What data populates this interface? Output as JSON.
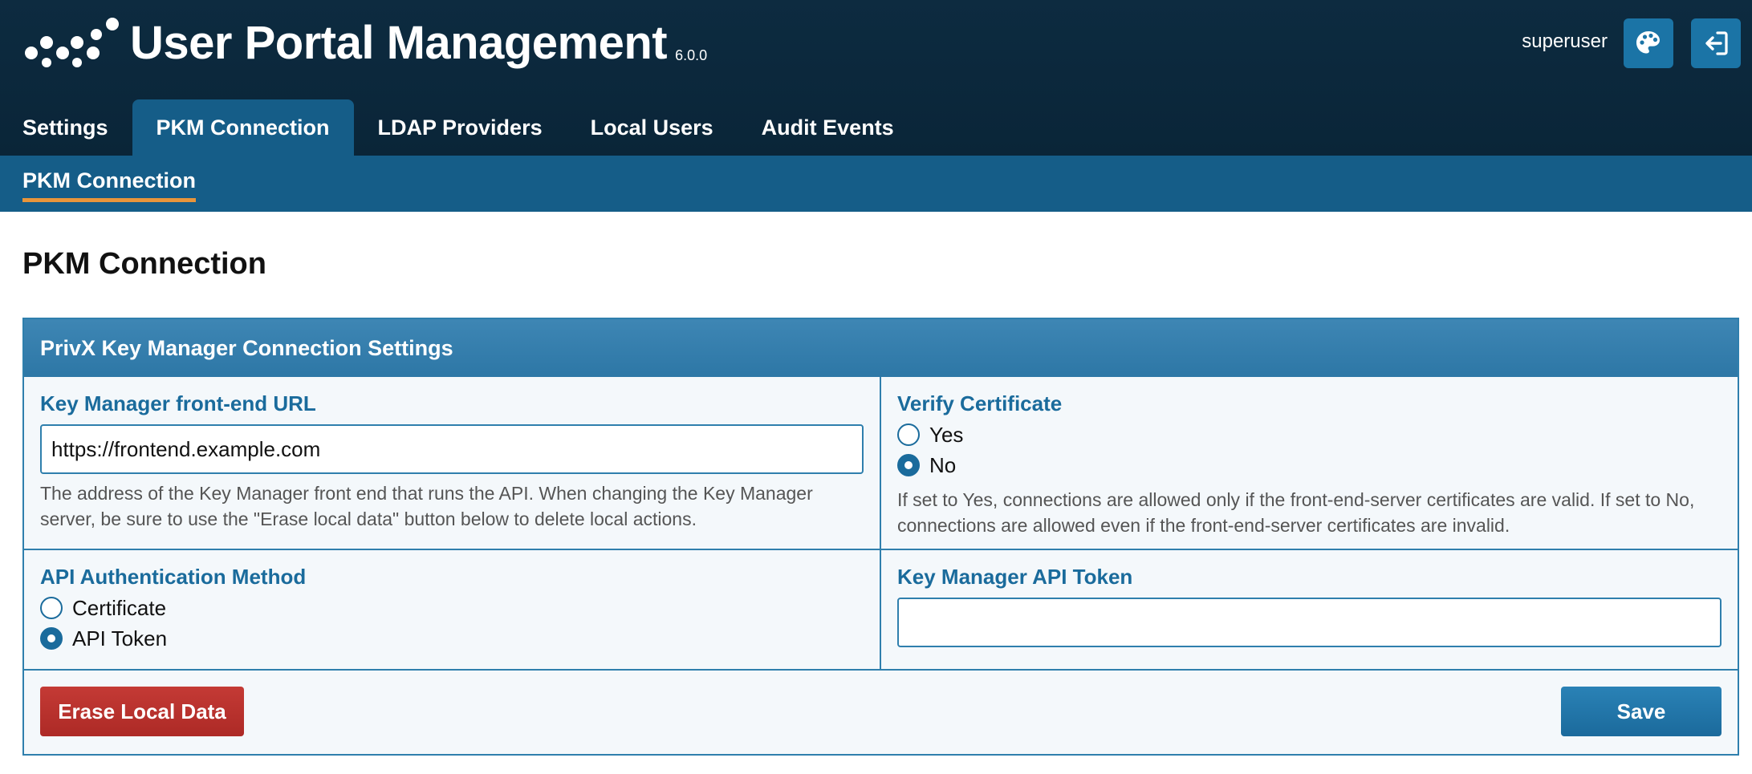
{
  "header": {
    "app_title": "User Portal Management",
    "version": "6.0.0",
    "user": "superuser",
    "theme_icon": "palette-icon",
    "logout_icon": "sign-out-icon"
  },
  "tabs": [
    {
      "label": "Settings",
      "active": false
    },
    {
      "label": "PKM Connection",
      "active": true
    },
    {
      "label": "LDAP Providers",
      "active": false
    },
    {
      "label": "Local Users",
      "active": false
    },
    {
      "label": "Audit Events",
      "active": false
    }
  ],
  "subnav": {
    "active": "PKM Connection"
  },
  "page": {
    "title": "PKM Connection"
  },
  "panel": {
    "title": "PrivX Key Manager Connection Settings",
    "frontend_url": {
      "label": "Key Manager front-end URL",
      "value": "https://frontend.example.com",
      "help": "The address of the Key Manager front end that runs the API. When changing the Key Manager server, be sure to use the \"Erase local data\" button below to delete local actions."
    },
    "verify_certificate": {
      "label": "Verify Certificate",
      "options": [
        {
          "label": "Yes",
          "selected": false
        },
        {
          "label": "No",
          "selected": true
        }
      ],
      "help": "If set to Yes, connections are allowed only if the front-end-server certificates are valid. If set to No, connections are allowed even if the front-end-server certificates are invalid."
    },
    "auth_method": {
      "label": "API Authentication Method",
      "options": [
        {
          "label": "Certificate",
          "selected": false
        },
        {
          "label": "API Token",
          "selected": true
        }
      ]
    },
    "api_token": {
      "label": "Key Manager API Token",
      "value": ""
    },
    "erase_button": "Erase Local Data",
    "save_button": "Save"
  },
  "colors": {
    "header_bg": "#0a2538",
    "accent": "#155d88",
    "subnav_underline": "#e8953b",
    "danger": "#b83030",
    "primary": "#1b6a9c"
  }
}
